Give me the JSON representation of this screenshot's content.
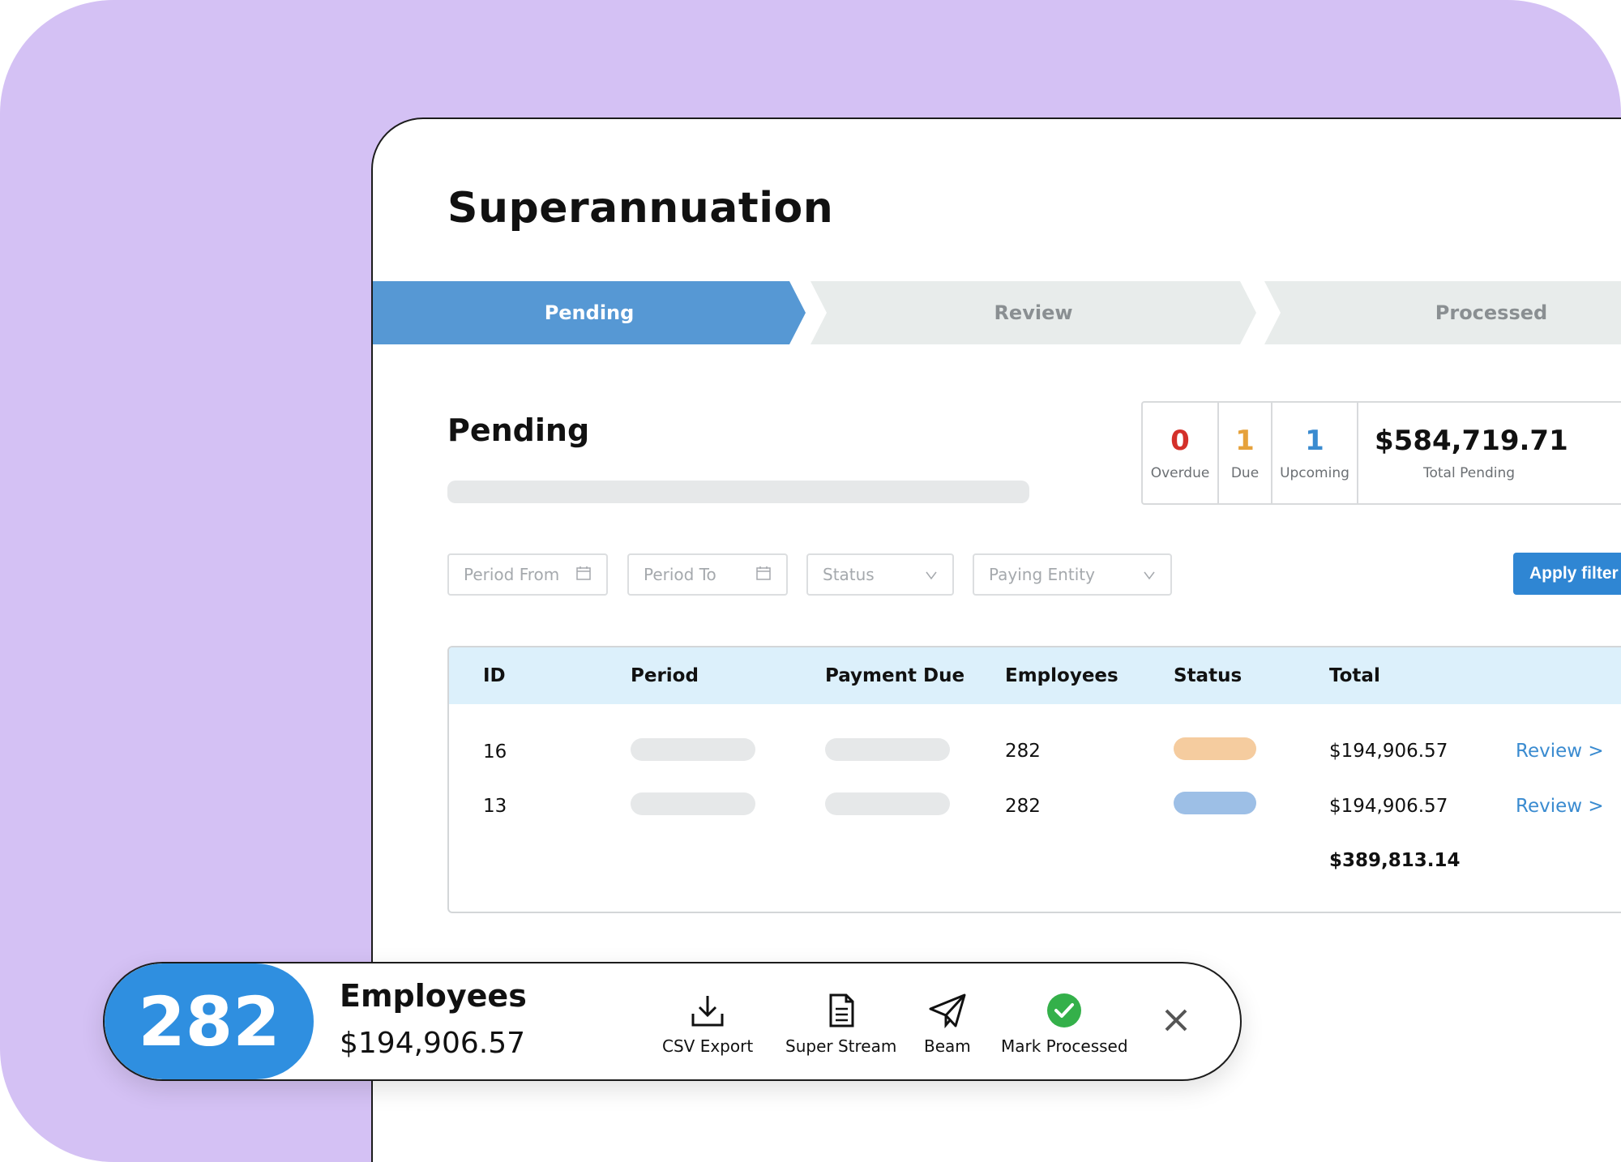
{
  "page": {
    "title": "Superannuation"
  },
  "stepper": {
    "steps": [
      {
        "label": "Pending",
        "active": true
      },
      {
        "label": "Review",
        "active": false
      },
      {
        "label": "Processed",
        "active": false
      }
    ]
  },
  "section": {
    "title": "Pending"
  },
  "stats": [
    {
      "value": "0",
      "label": "Overdue",
      "color": "#d4302a"
    },
    {
      "value": "1",
      "label": "Due",
      "color": "#e6a23c"
    },
    {
      "value": "1",
      "label": "Upcoming",
      "color": "#3a8bd0"
    },
    {
      "value": "$584,719.71",
      "label": "Total Pending",
      "color": "#111111"
    }
  ],
  "filters": {
    "period_from": "Period From",
    "period_to": "Period To",
    "status": "Status",
    "paying_entity": "Paying Entity",
    "apply_label": "Apply filter"
  },
  "table": {
    "columns": [
      "ID",
      "Period",
      "Payment Due",
      "Employees",
      "Status",
      "Total"
    ],
    "rows": [
      {
        "id": "16",
        "employees": "282",
        "status_color": "#f5cc9f",
        "total": "$194,906.57",
        "action": "Review >"
      },
      {
        "id": "13",
        "employees": "282",
        "status_color": "#9dbfe6",
        "total": "$194,906.57",
        "action": "Review >"
      }
    ],
    "grand_total": "$389,813.14"
  },
  "action_bar": {
    "count": "282",
    "label": "Employees",
    "amount": "$194,906.57",
    "actions": [
      {
        "label": "CSV Export",
        "icon": "download-icon"
      },
      {
        "label": "Super Stream",
        "icon": "document-icon"
      },
      {
        "label": "Beam",
        "icon": "paper-plane-icon"
      },
      {
        "label": "Mark Processed",
        "icon": "check-circle-icon"
      }
    ],
    "close_icon": "close-icon"
  },
  "colors": {
    "accent": "#2f86d3",
    "background_purple": "#d4c1f4",
    "table_header": "#dcf0fb"
  }
}
